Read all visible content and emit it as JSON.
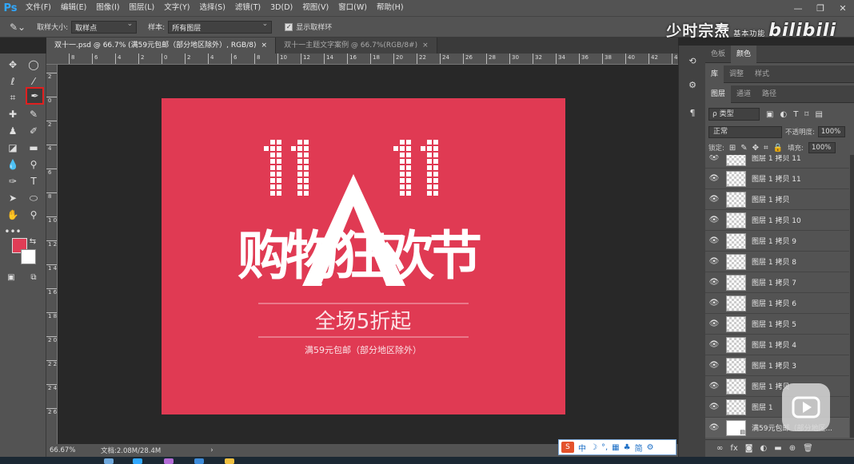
{
  "app": {
    "logo": "Ps"
  },
  "menu": [
    "文件(F)",
    "编辑(E)",
    "图像(I)",
    "图层(L)",
    "文字(Y)",
    "选择(S)",
    "滤镜(T)",
    "3D(D)",
    "视图(V)",
    "窗口(W)",
    "帮助(H)"
  ],
  "window_buttons": [
    "—",
    "❐",
    "✕"
  ],
  "options": {
    "sample_size_label": "取样大小:",
    "sample_size_value": "取样点",
    "sample_label": "样本:",
    "sample_value": "所有图层",
    "show_ring_label": "显示取样环",
    "show_ring_checked": true
  },
  "watermark": {
    "text": "少时宗焘",
    "small": "基本功能",
    "brand": "bilibili"
  },
  "tabs": [
    {
      "label": "双十一.psd @ 66.7% (满59元包邮（部分地区除外）, RGB/8)",
      "close": "×",
      "active": true
    },
    {
      "label": "双十一主题文字案例 @ 66.7%(RGB/8#)",
      "close": "×",
      "active": false
    }
  ],
  "ruler_top_labels": [
    "8",
    "6",
    "4",
    "2",
    "0",
    "2",
    "4",
    "6",
    "8",
    "10",
    "12",
    "14",
    "16",
    "18",
    "20",
    "22",
    "24",
    "26",
    "28",
    "30",
    "32",
    "34",
    "36",
    "38",
    "40",
    "42",
    "44"
  ],
  "ruler_left_labels": [
    "2",
    "0",
    "2",
    "4",
    "6",
    "8",
    "1 0",
    "1 2",
    "1 4",
    "1 6",
    "1 8",
    "2 0",
    "2 2",
    "2 4",
    "2 6"
  ],
  "artwork": {
    "bg_color": "#e03a53",
    "number_text": "11.11",
    "title": "购物狂欢节",
    "subtitle": "全场5折起",
    "note": "满59元包邮（部分地区除外）"
  },
  "status": {
    "zoom": "66.67%",
    "doc": "文档:2.08M/28.4M",
    "arrow": "›"
  },
  "ime": {
    "logo": "S",
    "items": [
      "中",
      "☽",
      "°,",
      "▦",
      "♣",
      "简",
      "⚙"
    ]
  },
  "panel_tabs_1": [
    "色板",
    "颜色"
  ],
  "panel_tabs_2": [
    "库",
    "调整",
    "样式"
  ],
  "panel_tabs_3": [
    "图层",
    "通道",
    "路径"
  ],
  "layers_panel": {
    "kind_label": "ρ 类型",
    "blend_mode": "正常",
    "opacity_label": "不透明度:",
    "opacity_value": "100%",
    "lock_label": "锁定:",
    "fill_label": "填充:",
    "fill_value": "100%",
    "layers": [
      "图层 1 拷贝 11",
      "图层 1 拷贝 11",
      "图层 1 拷贝",
      "图层 1 拷贝 10",
      "图层 1 拷贝 9",
      "图层 1 拷贝 8",
      "图层 1 拷贝 7",
      "图层 1 拷贝 6",
      "图层 1 拷贝 5",
      "图层 1 拷贝 4",
      "图层 1 拷贝 3",
      "图层 1 拷贝",
      "图层 1",
      "满59元包邮（部分地区..."
    ]
  },
  "colors": {
    "foreground": "#e03d56",
    "background": "#ffffff",
    "accent": "#31a8ff"
  }
}
